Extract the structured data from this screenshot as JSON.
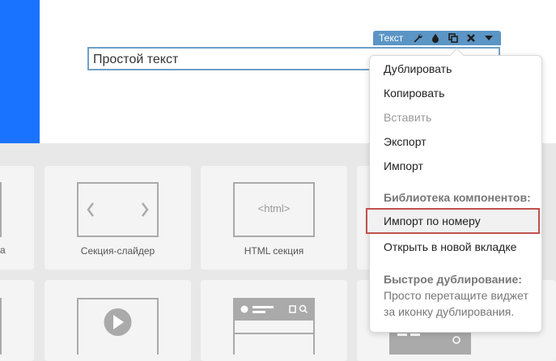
{
  "widget": {
    "text": "Простой текст",
    "toolbar_label": "Текст"
  },
  "toolbar_icons": [
    "wrench-icon",
    "drop-icon",
    "copy-icon",
    "close-icon",
    "chevron-down-icon"
  ],
  "cards": {
    "slider": {
      "label": "Секция-слайдер",
      "icon_text_left": "<",
      "icon_text_right": ">"
    },
    "html": {
      "label": "HTML секция",
      "icon_text": "<html>"
    }
  },
  "menu": {
    "duplicate": "Дублировать",
    "copy": "Копировать",
    "paste": "Вставить",
    "export": "Экспорт",
    "import": "Импорт",
    "library_header": "Библиотека компонентов:",
    "import_by_number": "Импорт по номеру",
    "open_new_tab": "Открыть в новой вкладке",
    "quick_dup_header": "Быстрое дублирование:",
    "quick_dup_text1": "Просто перетащите виджет",
    "quick_dup_text2": "за иконку дублирования."
  },
  "colors": {
    "accent_blue": "#1a73ff",
    "toolbar": "#5b95c5",
    "highlight_border": "#c0504d"
  }
}
